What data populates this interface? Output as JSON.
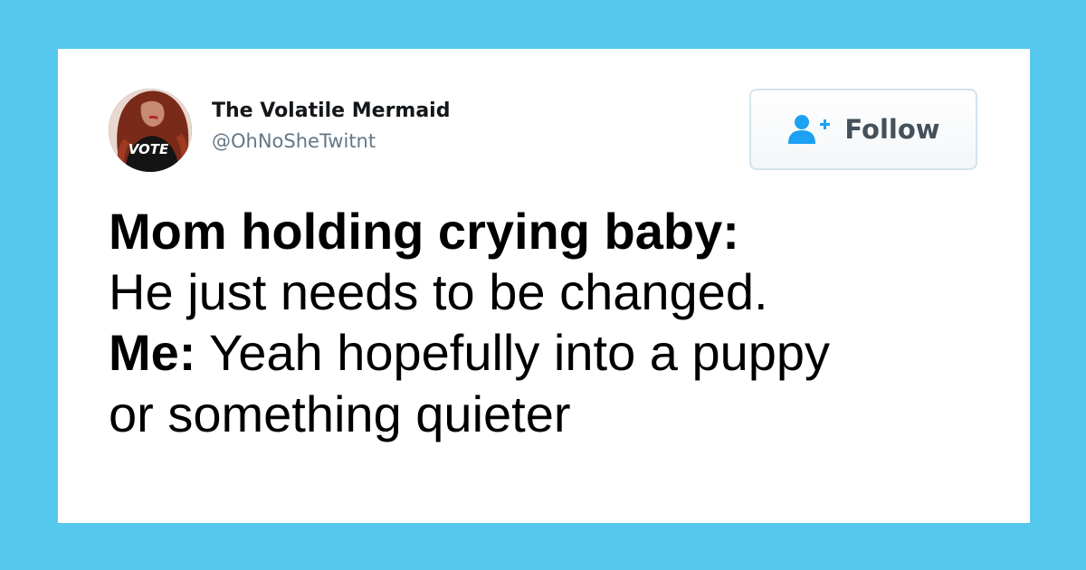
{
  "background_color": "#56c8ee",
  "tweet": {
    "user": {
      "display_name": "The Volatile Mermaid",
      "handle": "@OhNoSheTwitnt",
      "avatar": {
        "icon": "avatar-photo",
        "shirt_text": "VOTE"
      }
    },
    "follow_button": {
      "label": "Follow",
      "icon": "add-user-icon",
      "icon_color": "#1da1f2"
    },
    "text": {
      "line1_speaker": "Mom holding crying baby:",
      "line2": "He just needs to be changed.",
      "line3_speaker": "Me:",
      "line3_text": " Yeah hopefully into a puppy",
      "line4": "or something quieter"
    }
  }
}
